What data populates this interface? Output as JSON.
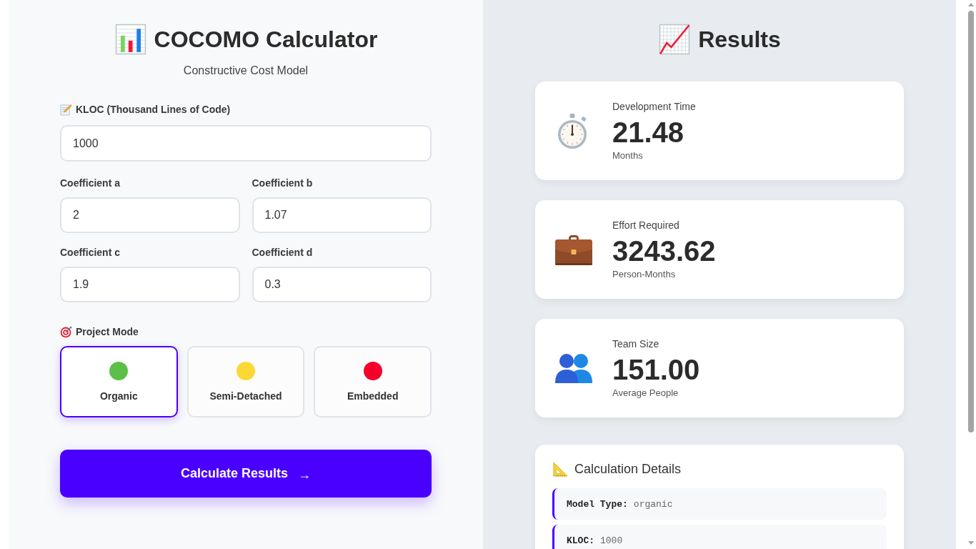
{
  "calculator": {
    "title": "COCOMO Calculator",
    "subtitle": "Constructive Cost Model",
    "kloc": {
      "label": "KLOC (Thousand Lines of Code)",
      "value": "1000"
    },
    "coefficients": [
      {
        "label": "Coefficient a",
        "value": "2"
      },
      {
        "label": "Coefficient b",
        "value": "1.07"
      },
      {
        "label": "Coefficient c",
        "value": "1.9"
      },
      {
        "label": "Coefficient d",
        "value": "0.3"
      }
    ],
    "project_mode": {
      "label": "Project Mode",
      "modes": [
        {
          "label": "Organic",
          "color": "#5cbf47",
          "selected": true
        },
        {
          "label": "Semi-Detached",
          "color": "#fdd835",
          "selected": false
        },
        {
          "label": "Embedded",
          "color": "#f5002a",
          "selected": false
        }
      ]
    },
    "calculate_button": {
      "label": "Calculate Results",
      "arrow": "→"
    }
  },
  "results": {
    "title": "Results",
    "cards": [
      {
        "kind": "time",
        "label": "Development Time",
        "value": "21.48",
        "unit": "Months"
      },
      {
        "kind": "effort",
        "label": "Effort Required",
        "value": "3243.62",
        "unit": "Person-Months"
      },
      {
        "kind": "team",
        "label": "Team Size",
        "value": "151.00",
        "unit": "Average People"
      }
    ],
    "details": {
      "title": "Calculation Details",
      "items": [
        {
          "label": "Model Type:",
          "value": "organic"
        },
        {
          "label": "KLOC:",
          "value": "1000"
        }
      ]
    }
  }
}
